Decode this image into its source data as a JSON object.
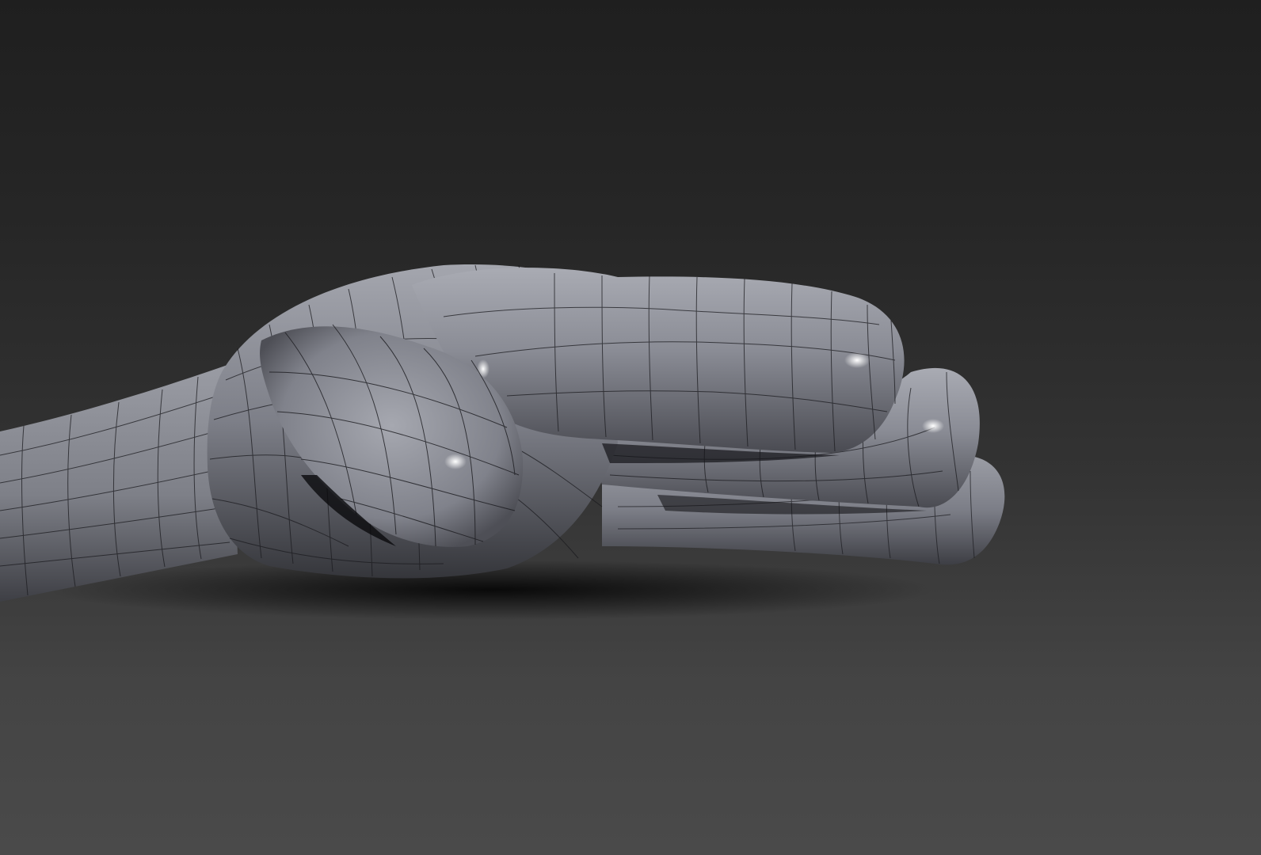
{
  "viewport": {
    "background_top": "#1f1f1f",
    "background_bottom": "#4a4a4a",
    "model": "hand-mesh",
    "shading": "smooth-with-wireframe",
    "mesh_color": "#8c8e96",
    "wire_color": "#1a1a1e"
  }
}
